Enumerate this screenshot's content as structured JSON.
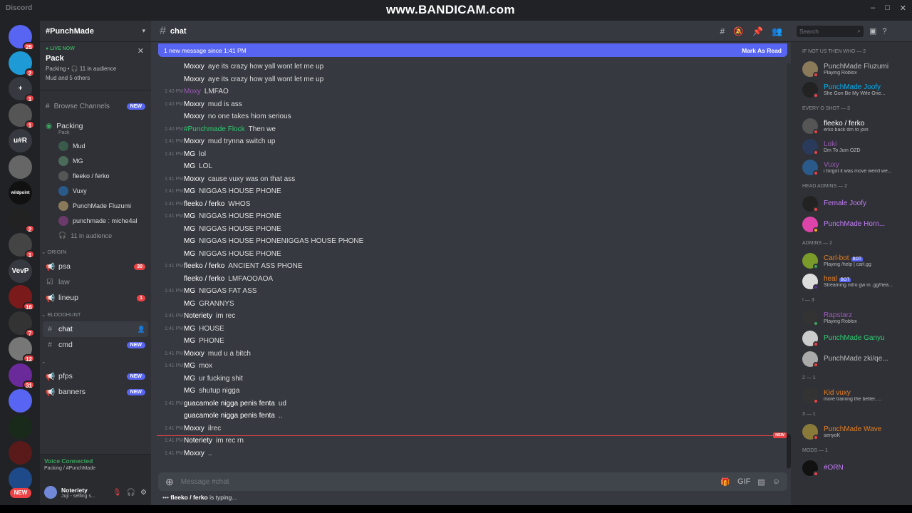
{
  "app_title": "Discord",
  "watermark": "www.BANDICAM.com",
  "window_controls": [
    "–",
    "□",
    "✕"
  ],
  "servers": [
    {
      "label": "",
      "badge": "25",
      "color": "#5865f2"
    },
    {
      "label": "",
      "badge": "2",
      "color": "#1e9bd7"
    },
    {
      "label": "+",
      "badge": "1",
      "color": "#36393f"
    },
    {
      "label": "",
      "badge": "1",
      "color": "#555"
    },
    {
      "label": "u#R",
      "badge": "",
      "color": "#36393f"
    },
    {
      "label": "",
      "badge": "",
      "color": "#666"
    },
    {
      "label": "wildpoint",
      "badge": "",
      "color": "#111"
    },
    {
      "label": "",
      "badge": "2",
      "color": "#222"
    },
    {
      "label": "",
      "badge": "1",
      "color": "#444"
    },
    {
      "label": "VevP",
      "badge": "",
      "color": "#36393f"
    },
    {
      "label": "",
      "badge": "16",
      "color": "#7a1a1a"
    },
    {
      "label": "",
      "badge": "7",
      "color": "#333"
    },
    {
      "label": "",
      "badge": "12",
      "color": "#777"
    },
    {
      "label": "",
      "badge": "31",
      "color": "#6a2a9a"
    },
    {
      "label": "",
      "badge": "",
      "color": "#5865f2"
    },
    {
      "label": "",
      "badge": "",
      "color": "#1a2a1a"
    },
    {
      "label": "",
      "badge": "",
      "color": "#5a1a1a"
    },
    {
      "label": "",
      "badge": "",
      "color": "#1e4a8a"
    }
  ],
  "rail_new": "NEW",
  "guild": {
    "name": "#PunchMade"
  },
  "live": {
    "tag": "LIVE NOW",
    "title": "Pack",
    "sub": "Packing • 🎧 11 in audience",
    "sub2": "Mud and 5 others"
  },
  "browse": {
    "label": "Browse Channels",
    "badge": "NEW"
  },
  "voice_channel": {
    "name": "Packing",
    "sub": "Pack",
    "members": [
      {
        "name": "Mud",
        "color": "#3a5a4a"
      },
      {
        "name": "MG",
        "color": "#4a6a5a"
      },
      {
        "name": "fleeko / ferko",
        "color": "#555"
      },
      {
        "name": "Vuxy",
        "color": "#2a5a8a"
      },
      {
        "name": "PunchMade Fluzumi",
        "color": "#8a7a5a"
      },
      {
        "name": "punchmade : miche4al",
        "color": "#6a3a6a"
      }
    ],
    "audience": "11 in audience"
  },
  "categories": [
    {
      "name": "ORIGIN",
      "channels": [
        {
          "name": "psa",
          "icon": "📢",
          "count": "30",
          "bright": true
        },
        {
          "name": "law",
          "icon": "☑",
          "count": "",
          "bright": false
        },
        {
          "name": "lineup",
          "icon": "📢",
          "count": "1",
          "bright": true
        }
      ]
    },
    {
      "name": "BLOODHUNT",
      "channels": [
        {
          "name": "chat",
          "icon": "#",
          "active": true
        },
        {
          "name": "cmd",
          "icon": "#",
          "new": "NEW",
          "bright": true
        }
      ]
    },
    {
      "name": "",
      "channels": [
        {
          "name": "pfps",
          "icon": "📢",
          "new": "NEW",
          "bright": true
        },
        {
          "name": "banners",
          "icon": "📢",
          "new": "NEW",
          "bright": true
        }
      ]
    }
  ],
  "voicebar": {
    "status": "Voice Connected",
    "channel": "Packing / #PunchMade"
  },
  "user": {
    "name": "Noteriety",
    "status": "Juji - selling s..."
  },
  "channel_header": {
    "name": "chat"
  },
  "newbar": {
    "text": "1 new message since 1:41 PM",
    "action": "Mark As Read"
  },
  "messages": [
    {
      "time": "",
      "author": "Moxxy",
      "text": "aye its crazy how yall wont let me up",
      "color": "#ffffff"
    },
    {
      "time": "",
      "author": "Moxxy",
      "text": "aye its crazy how yall wont let me up",
      "color": "#ffffff"
    },
    {
      "time": "1:40 PM",
      "author": "Moxy",
      "text": "LMFAO",
      "color": "#9b59b6"
    },
    {
      "time": "1:40 PM",
      "author": "Moxxy",
      "text": "mud is ass",
      "color": "#ffffff"
    },
    {
      "time": "",
      "author": "Moxxy",
      "text": "no one takes hiom serious",
      "color": "#ffffff"
    },
    {
      "time": "1:40 PM",
      "author": "#Punchmade Flock",
      "text": "Then we",
      "color": "#2ecc71"
    },
    {
      "time": "1:41 PM",
      "author": "Moxxy",
      "text": "mud trynna switch up",
      "color": "#ffffff"
    },
    {
      "time": "1:41 PM",
      "author": "MG",
      "text": "lol",
      "color": "#ffffff"
    },
    {
      "time": "",
      "author": "MG",
      "text": "LOL",
      "color": "#ffffff"
    },
    {
      "time": "1:41 PM",
      "author": "Moxxy",
      "text": "cause vuxy was on that ass",
      "color": "#ffffff"
    },
    {
      "time": "1:41 PM",
      "author": "MG",
      "text": "NIGGAS HOUSE PHONE",
      "color": "#ffffff"
    },
    {
      "time": "1:41 PM",
      "author": "fleeko / ferko",
      "text": "WHOS",
      "color": "#ffffff"
    },
    {
      "time": "1:41 PM",
      "author": "MG",
      "text": "NIGGAS HOUSE PHONE",
      "color": "#ffffff"
    },
    {
      "time": "",
      "author": "MG",
      "text": "NIGGAS HOUSE PHONE",
      "color": "#ffffff"
    },
    {
      "time": "",
      "author": "MG",
      "text": "NIGGAS HOUSE PHONENIGGAS HOUSE PHONE",
      "color": "#ffffff"
    },
    {
      "time": "",
      "author": "MG",
      "text": "NIGGAS HOUSE PHONE",
      "color": "#ffffff"
    },
    {
      "time": "1:41 PM",
      "author": "fleeko / ferko",
      "text": "ANCIENT ASS PHONE",
      "color": "#ffffff"
    },
    {
      "time": "",
      "author": "fleeko / ferko",
      "text": "LMFAOOAOA",
      "color": "#ffffff"
    },
    {
      "time": "1:41 PM",
      "author": "MG",
      "text": "NIGGAS FAT ASS",
      "color": "#ffffff"
    },
    {
      "time": "",
      "author": "MG",
      "text": "GRANNYS",
      "color": "#ffffff"
    },
    {
      "time": "1:41 PM",
      "author": "Noteriety",
      "text": "im rec",
      "color": "#ffffff"
    },
    {
      "time": "1:41 PM",
      "author": "MG",
      "text": "HOUSE",
      "color": "#ffffff"
    },
    {
      "time": "",
      "author": "MG",
      "text": "PHONE",
      "color": "#ffffff"
    },
    {
      "time": "1:41 PM",
      "author": "Moxxy",
      "text": "mud u a bitch",
      "color": "#ffffff"
    },
    {
      "time": "1:41 PM",
      "author": "MG",
      "text": "mox",
      "color": "#ffffff"
    },
    {
      "time": "",
      "author": "MG",
      "text": "ur fucking shit",
      "color": "#ffffff"
    },
    {
      "time": "",
      "author": "MG",
      "text": "shutup nigga",
      "color": "#ffffff"
    },
    {
      "time": "1:41 PM",
      "author": "guacamole nigga penis fenta",
      "text": "ud",
      "color": "#ffffff"
    },
    {
      "time": "",
      "author": "guacamole nigga penis fenta",
      "text": "..",
      "color": "#ffffff"
    },
    {
      "time": "1:41 PM",
      "author": "Moxxy",
      "text": "ilrec",
      "color": "#ffffff"
    },
    {
      "time": "1:41 PM",
      "author": "Noteriety",
      "text": "im rec rn",
      "color": "#ffffff"
    },
    {
      "time": "1:41 PM",
      "author": "Moxxy",
      "text": "..",
      "color": "#ffffff"
    }
  ],
  "new_divider": "NEW",
  "composer": {
    "placeholder": "Message #chat"
  },
  "typing": {
    "who": "fleeko / ferko",
    "suffix": " is typing..."
  },
  "members_search": "Search",
  "member_groups": [
    {
      "role": "IF NOT US THEN WHO — 2",
      "members": [
        {
          "name": "PunchMade Fluzumi",
          "activity": "Playing Roblox",
          "color": "#b9bbbe",
          "avatar": "#8a7a5a",
          "status": "#ed4245"
        },
        {
          "name": "PunchMade Joofy",
          "activity": "She Gon Be My Wife One...",
          "color": "#00b0f4",
          "avatar": "#222",
          "status": "#ed4245"
        }
      ]
    },
    {
      "role": "EVERY O SHOT — 3",
      "members": [
        {
          "name": "fleeko / ferko",
          "activity": "erko back dm to join",
          "color": "#ffffff",
          "avatar": "#555",
          "status": "#ed4245"
        },
        {
          "name": "Loki",
          "activity": "Dm To Join OZD",
          "color": "#9b59b6",
          "avatar": "#2a3a5a",
          "status": "#ed4245"
        },
        {
          "name": "Vuxy",
          "activity": "i forgot it was move weird we...",
          "color": "#9b59b6",
          "avatar": "#2a5a8a",
          "status": "#ed4245"
        }
      ]
    },
    {
      "role": "HEAD ADMINS — 2",
      "members": [
        {
          "name": "Female Joofy",
          "activity": "",
          "color": "#c27cf6",
          "avatar": "#222",
          "status": "#ed4245"
        },
        {
          "name": "PunchMade Horn...",
          "activity": "",
          "color": "#c27cf6",
          "avatar": "#d4a",
          "status": "#faa61a"
        }
      ]
    },
    {
      "role": "ADMINS — 2",
      "members": [
        {
          "name": "Carl-bot",
          "activity": "Playing /help | carl.gg",
          "color": "#e67e22",
          "avatar": "#7a9a2a",
          "status": "#3ba55d",
          "bot": "BOT"
        },
        {
          "name": "heal",
          "activity": "Streaming nitro gw in .gg/hea...",
          "color": "#e67e22",
          "avatar": "#ddd",
          "status": "#593695",
          "bot": "BOT"
        }
      ]
    },
    {
      "role": "! — 3",
      "members": [
        {
          "name": "Rapstarz",
          "activity": "Playing Roblox",
          "color": "#9b59b6",
          "avatar": "#333",
          "status": "#3ba55d"
        },
        {
          "name": "PunchMade Ganyu",
          "activity": "",
          "color": "#2ecc71",
          "avatar": "#ccc",
          "status": "#ed4245"
        },
        {
          "name": "PunchMade zki/qe...",
          "activity": "",
          "color": "#b9bbbe",
          "avatar": "#aaa",
          "status": "#ed4245"
        }
      ]
    },
    {
      "role": "2 — 1",
      "members": [
        {
          "name": "Kid vuxy",
          "activity": "more training the better, ...",
          "color": "#e67e22",
          "avatar": "#333",
          "status": "#ed4245"
        }
      ]
    },
    {
      "role": "3 — 1",
      "members": [
        {
          "name": "PunchMade Wave",
          "activity": "senyoK",
          "color": "#e67e22",
          "avatar": "#8a7a3a",
          "status": "#ed4245"
        }
      ]
    },
    {
      "role": "MODS — 1",
      "members": [
        {
          "name": "#ORN",
          "activity": "",
          "color": "#c27cf6",
          "avatar": "#111",
          "status": "#ed4245"
        }
      ]
    }
  ]
}
